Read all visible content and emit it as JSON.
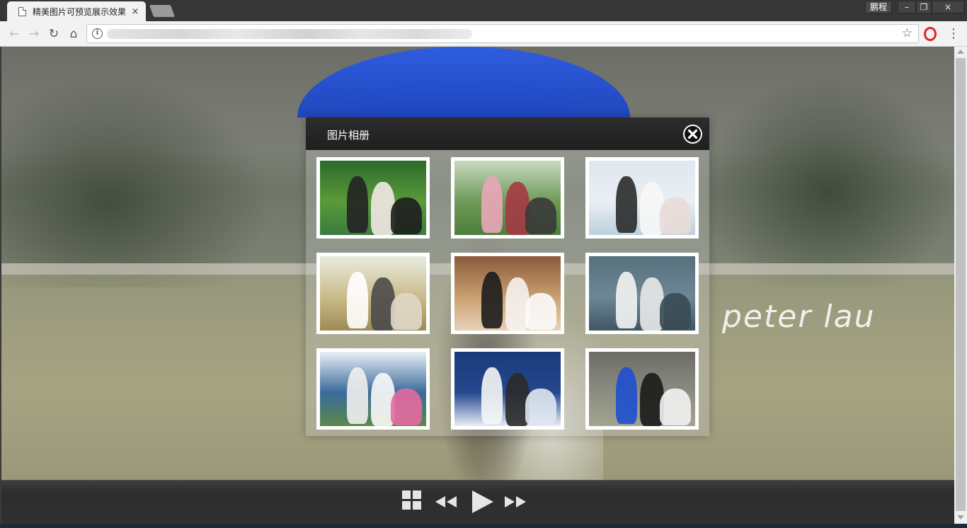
{
  "browser": {
    "tab_title": "精美图片可预览展示效果",
    "tab_close": "×",
    "profile_label": "鹏程",
    "window_min": "–",
    "window_restore": "❐",
    "window_close": "×"
  },
  "toolbar": {
    "back_icon": "←",
    "forward_icon": "→",
    "reload_icon": "↻",
    "home_icon": "⌂",
    "info_icon": "i",
    "bookmark_icon": "☆",
    "menu_icon": "⋮"
  },
  "page": {
    "watermark": "peter lau"
  },
  "album": {
    "title": "图片相册",
    "thumbnails": [
      {
        "palette": [
          "#2c6b2a",
          "#5a9a3a",
          "#3a7a3e"
        ],
        "figures": [
          "#222",
          "#f2e8e6",
          "#1e1e1e"
        ]
      },
      {
        "palette": [
          "#c8d9c0",
          "#6f9a58",
          "#4e7d3c"
        ],
        "figures": [
          "#e9a7b8",
          "#a43a44",
          "#3a3a3a"
        ]
      },
      {
        "palette": [
          "#dfe8ef",
          "#e9eef3",
          "#bcd0de"
        ],
        "figures": [
          "#2a2a2a",
          "#f7f7f7",
          "#e8dcd8"
        ]
      },
      {
        "palette": [
          "#e8ecdf",
          "#c9bb8a",
          "#9d8b55"
        ],
        "figures": [
          "#ffffff",
          "#4a4a4a",
          "#e0d8c8"
        ]
      },
      {
        "palette": [
          "#8a5a3a",
          "#c9a070",
          "#e6d2b8"
        ],
        "figures": [
          "#1c1c1c",
          "#f6f2ee",
          "#fbfbfb"
        ]
      },
      {
        "palette": [
          "#56707e",
          "#6d8796",
          "#3f5664"
        ],
        "figures": [
          "#f4f4f4",
          "#e9e9e9",
          "#3a4a52"
        ]
      },
      {
        "palette": [
          "#e8f0f6",
          "#3a6a9a",
          "#5a8a4a"
        ],
        "figures": [
          "#f0f0f0",
          "#fafafa",
          "#e46aa0"
        ]
      },
      {
        "palette": [
          "#1a3a7a",
          "#24488e",
          "#e8eef6"
        ],
        "figures": [
          "#f6f6f6",
          "#2a2a2a",
          "#dfe6ee"
        ]
      },
      {
        "palette": [
          "#6c6c66",
          "#8b8d82",
          "#a3a48e"
        ],
        "figures": [
          "#1e4fcf",
          "#1a1a1a",
          "#f2f2f2"
        ]
      }
    ]
  },
  "controls": {
    "grid_label": "grid-icon",
    "prev_label": "rewind-icon",
    "play_label": "play-icon",
    "next_label": "fast-forward-icon"
  },
  "colors": {
    "accent_umbrella": "#2056d8",
    "modal_header": "#252525",
    "controlbar": "#313131",
    "browser_frame": "#363636"
  }
}
